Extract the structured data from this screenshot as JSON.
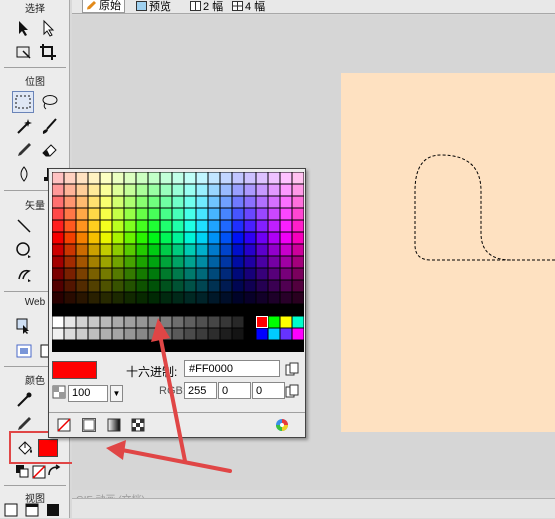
{
  "toolbox": {
    "select_label": "选择",
    "bitmap_label": "位图",
    "vector_label": "矢量",
    "web_label": "Web",
    "colors_label": "颜色",
    "view_label": "视图"
  },
  "tabs": [
    {
      "label": "原始",
      "active": true
    },
    {
      "label": "预览",
      "active": false
    },
    {
      "label": "2 幅",
      "active": false
    },
    {
      "label": "4 幅",
      "active": false
    }
  ],
  "document_label": "GIF 动画 (文档)",
  "canvas_color": "#fee1c1",
  "color_popup": {
    "hex_label": "十六进制:",
    "hex_value": "#FF0000",
    "rgb_label": "RGB:",
    "r": "255",
    "g": "0",
    "b": "0",
    "alpha": "100",
    "selected_color": "#ff0000"
  },
  "accent_colors": {
    "annotation": "#e04646",
    "selection": "#6a84b8"
  }
}
